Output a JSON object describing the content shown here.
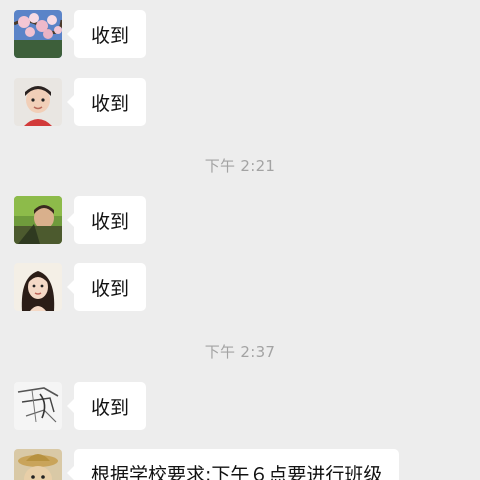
{
  "messages": [
    {
      "avatar": "blossom-avatar",
      "text": "收到"
    },
    {
      "avatar": "child-avatar",
      "text": "收到"
    },
    {
      "avatar": "greenery-avatar",
      "text": "收到"
    },
    {
      "avatar": "woman-portrait-avatar",
      "text": "收到"
    },
    {
      "avatar": "sketch-avatar",
      "text": "收到"
    },
    {
      "avatar": "cat-hat-avatar",
      "text": "根据学校要求:下午６点要进行班级"
    }
  ],
  "timestamps": [
    "下午 2:21",
    "下午 2:37"
  ],
  "colors": {
    "background": "#ededed",
    "bubble": "#ffffff",
    "timestamp_text": "#a3a3a3",
    "message_text": "#111111"
  }
}
